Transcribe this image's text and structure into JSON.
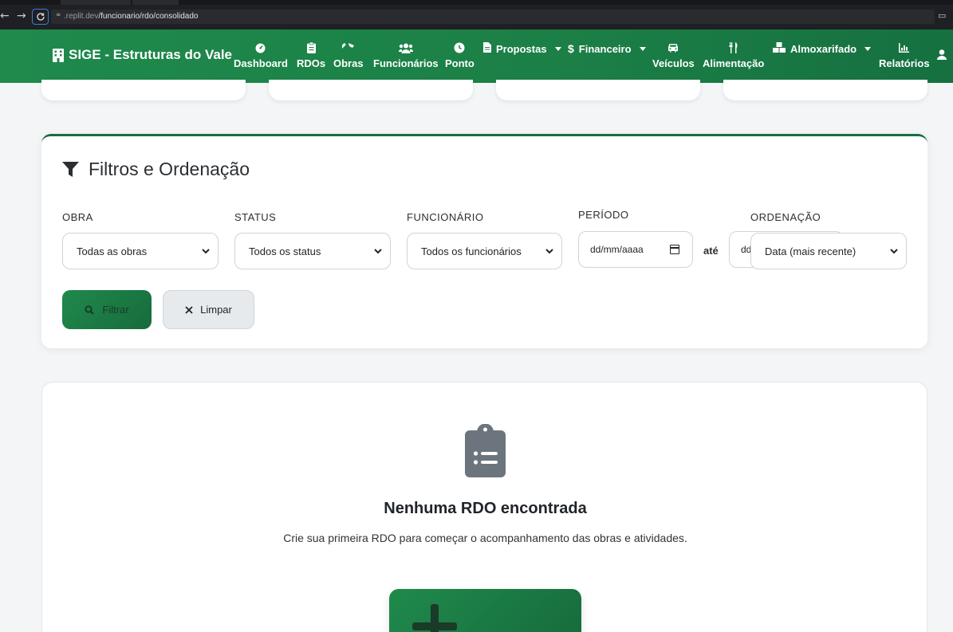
{
  "browser": {
    "url_dim": ".replit.dev",
    "url_path": "/funcionario/rdo/consolidado"
  },
  "navbar": {
    "brand": "SIGE - Estruturas do Vale",
    "items": [
      {
        "label": "Dashboard",
        "icon": "gauge-icon"
      },
      {
        "label": "RDOs",
        "icon": "clipboard-icon"
      },
      {
        "label": "Obras",
        "icon": "hammer-icon"
      },
      {
        "label": "Funcionários",
        "icon": "users-icon"
      },
      {
        "label": "Ponto",
        "icon": "clock-icon"
      },
      {
        "label": "Propostas",
        "icon": "file-icon"
      },
      {
        "label": "Financeiro",
        "icon": "dollar-icon"
      },
      {
        "label": "Veículos",
        "icon": "car-icon"
      },
      {
        "label": "Alimentação",
        "icon": "utensils-icon"
      },
      {
        "label": "Almoxarifado",
        "icon": "boxes-icon"
      },
      {
        "label": "Relatórios",
        "icon": "chart-icon"
      }
    ]
  },
  "filters": {
    "title": "Filtros e Ordenação",
    "obra_label": "OBRA",
    "obra_value": "Todas as obras",
    "status_label": "STATUS",
    "status_value": "Todos os status",
    "funcionario_label": "FUNCIONÁRIO",
    "funcionario_value": "Todos os funcionários",
    "periodo_label": "PERÍODO",
    "date_from": "dd/mm/aaaa",
    "ate": "até",
    "date_to": "dd/mm/aaaa",
    "ordenacao_label": "ORDENAÇÃO",
    "ordenacao_value": "Data (mais recente)",
    "filtrar": "Filtrar",
    "limpar": "Limpar"
  },
  "empty": {
    "title": "Nenhuma RDO encontrada",
    "subtitle": "Crie sua primeira RDO para começar o acompanhamento das obras e atividades."
  }
}
